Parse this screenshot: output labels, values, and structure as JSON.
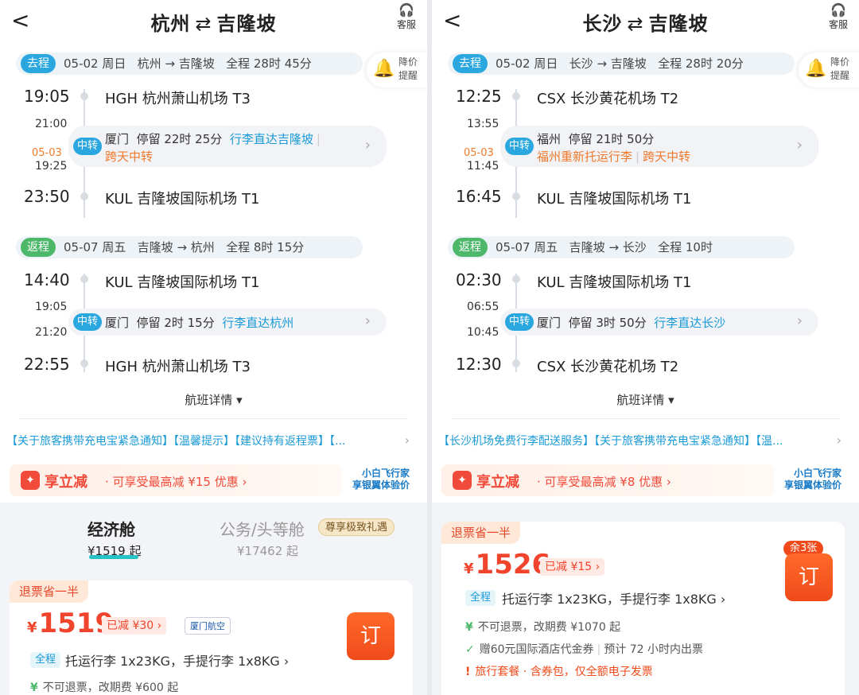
{
  "left": {
    "header": {
      "back": "<",
      "from": "杭州",
      "swap": "⇄",
      "to": "吉隆坡",
      "service": "客服"
    },
    "alert": {
      "line1": "降价",
      "line2": "提醒"
    },
    "outbound": {
      "tag": "去程",
      "date": "05-02 周日",
      "route": "杭州 → 吉隆坡",
      "total": "全程 28时 45分",
      "dep_time": "19:05",
      "dep_airport": "HGH 杭州萧山机场 T3",
      "stop_arr": "21:00",
      "stop_next": "05-03",
      "stop_dep": "19:25",
      "badge": "中转",
      "stop_city": "厦门",
      "stop_dur": "停留 22时 25分",
      "stop_note": "行李直达吉隆坡",
      "stop_note2": "跨天中转",
      "arr_time": "23:50",
      "arr_airport": "KUL 吉隆坡国际机场 T1"
    },
    "return": {
      "tag": "返程",
      "date": "05-07 周五",
      "route": "吉隆坡 → 杭州",
      "total": "全程 8时 15分",
      "dep_time": "14:40",
      "dep_airport": "KUL 吉隆坡国际机场 T1",
      "stop_arr": "19:05",
      "stop_dep": "21:20",
      "badge": "中转",
      "stop_city": "厦门",
      "stop_dur": "停留 2时 15分",
      "stop_note": "行李直达杭州",
      "arr_time": "22:55",
      "arr_airport": "HGH 杭州萧山机场 T3"
    },
    "details": "航班详情 ▾",
    "notice": "【关于旅客携带充电宝紧急通知】【温馨提示】【建议持有返程票】【...",
    "promo": {
      "title": "享立减",
      "desc": "· 可享受最高减 ¥15 优惠 ›",
      "r1": "小白飞行家",
      "r2": "享银翼体验价"
    },
    "cabins": {
      "econ": "经济舱",
      "econ_price": "¥1519 起",
      "biz": "公务/头等舱",
      "biz_price": "¥17462 起",
      "biz_badge": "尊享极致礼遇"
    },
    "card": {
      "refund": "退票省一半",
      "cur": "¥",
      "price": "1519",
      "reduce": "已减 ¥30 ›",
      "airline": "厦门航空",
      "book": "订",
      "full": "全程",
      "bag": "托运行李 1x23KG，手提行李 1x8KG ›",
      "n1": "不可退票，改期费 ¥600 起"
    }
  },
  "right": {
    "header": {
      "back": "<",
      "from": "长沙",
      "swap": "⇄",
      "to": "吉隆坡",
      "service": "客服"
    },
    "alert": {
      "line1": "降价",
      "line2": "提醒"
    },
    "outbound": {
      "tag": "去程",
      "date": "05-02 周日",
      "route": "长沙 → 吉隆坡",
      "total": "全程 28时 20分",
      "dep_time": "12:25",
      "dep_airport": "CSX 长沙黄花机场 T2",
      "stop_arr": "13:55",
      "stop_next": "05-03",
      "stop_dep": "11:45",
      "badge": "中转",
      "stop_city": "福州",
      "stop_dur": "停留 21时 50分",
      "stop_note": "福州重新托运行李",
      "stop_note2": "跨天中转",
      "arr_time": "16:45",
      "arr_airport": "KUL 吉隆坡国际机场 T1"
    },
    "return": {
      "tag": "返程",
      "date": "05-07 周五",
      "route": "吉隆坡 → 长沙",
      "total": "全程 10时",
      "dep_time": "02:30",
      "dep_airport": "KUL 吉隆坡国际机场 T1",
      "stop_arr": "06:55",
      "stop_dep": "10:45",
      "badge": "中转",
      "stop_city": "厦门",
      "stop_dur": "停留 3时 50分",
      "stop_note": "行李直达长沙",
      "arr_time": "12:30",
      "arr_airport": "CSX 长沙黄花机场 T2"
    },
    "details": "航班详情 ▾",
    "notice": "【长沙机场免费行李配送服务】【关于旅客携带充电宝紧急通知】【温...",
    "promo": {
      "title": "享立减",
      "desc": "· 可享受最高减 ¥8 优惠 ›",
      "r1": "小白飞行家",
      "r2": "享银翼体验价"
    },
    "card": {
      "refund": "退票省一半",
      "cur": "¥",
      "price": "1526",
      "reduce": "已减 ¥15 ›",
      "left": "余3张",
      "book": "订",
      "full": "全程",
      "bag": "托运行李 1x23KG，手提行李 1x8KG ›",
      "n1": "不可退票，改期费 ¥1070 起",
      "n2": "赠60元国际酒店代金券",
      "n2b": "预计 72 小时内出票",
      "n3": "旅行套餐 · 含券包，仅全额电子发票"
    }
  }
}
